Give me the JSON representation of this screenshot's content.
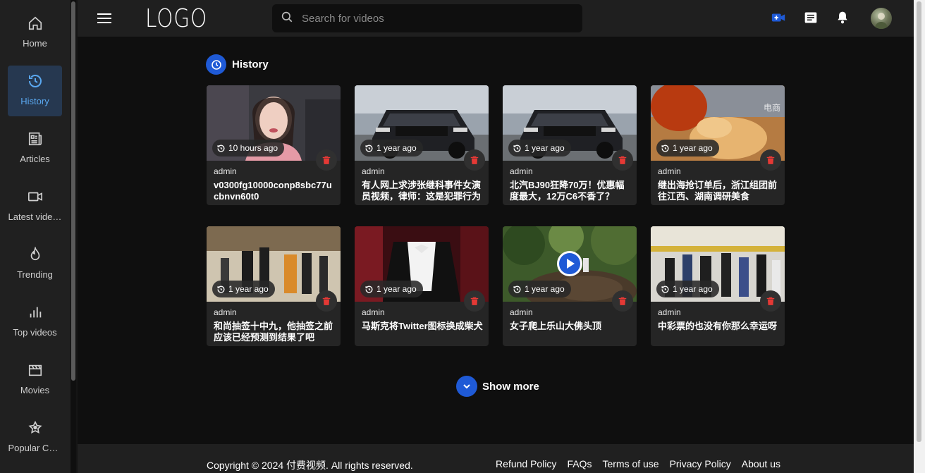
{
  "sidebar": {
    "items": [
      {
        "label": "Home",
        "icon": "home-icon",
        "active": false
      },
      {
        "label": "History",
        "icon": "history-icon",
        "active": true
      },
      {
        "label": "Articles",
        "icon": "articles-icon",
        "active": false
      },
      {
        "label": "Latest videos",
        "icon": "video-icon",
        "active": false
      },
      {
        "label": "Trending",
        "icon": "flame-icon",
        "active": false
      },
      {
        "label": "Top videos",
        "icon": "bar-chart-icon",
        "active": false
      },
      {
        "label": "Movies",
        "icon": "clapper-icon",
        "active": false
      },
      {
        "label": "Popular Channels",
        "icon": "star-badge-icon",
        "active": false
      }
    ]
  },
  "header": {
    "logo": "LOGO",
    "search_placeholder": "Search for videos"
  },
  "section": {
    "title": "History"
  },
  "cards": [
    {
      "time": "10 hours ago",
      "author": "admin",
      "title": "v0300fg10000conp8sbc77ucbnvn60t0",
      "thumb": "girl"
    },
    {
      "time": "1 year ago",
      "author": "admin",
      "title": "有人网上求涉张继科事件女演员视频，律师：这是犯罪行为",
      "thumb": "car"
    },
    {
      "time": "1 year ago",
      "author": "admin",
      "title": "北汽BJ90狂降70万！优惠幅度最大，12万C6不香了？",
      "thumb": "car"
    },
    {
      "time": "1 year ago",
      "author": "admin",
      "title": "继出海抢订单后，浙江组团前往江西、湖南调研美食",
      "thumb": "food"
    },
    {
      "time": "1 year ago",
      "author": "admin",
      "title": "和尚抽签十中九，他抽签之前应该已经预测到结果了吧",
      "thumb": "monk"
    },
    {
      "time": "1 year ago",
      "author": "admin",
      "title": "马斯克将Twitter图标换成柴犬",
      "thumb": "suit"
    },
    {
      "time": "1 year ago",
      "author": "admin",
      "title": "女子爬上乐山大佛头顶",
      "thumb": "forest"
    },
    {
      "time": "1 year ago",
      "author": "admin",
      "title": "中彩票的也没有你那么幸运呀",
      "thumb": "crowd"
    }
  ],
  "show_more": "Show more",
  "footer": {
    "copyright": "Copyright © 2024 付费视频. All rights reserved.",
    "links": [
      "Refund Policy",
      "FAQs",
      "Terms of use",
      "Privacy Policy",
      "About us"
    ]
  },
  "colors": {
    "accent": "#1f5ad6",
    "delete": "#e53935",
    "active_bg": "#263850"
  }
}
